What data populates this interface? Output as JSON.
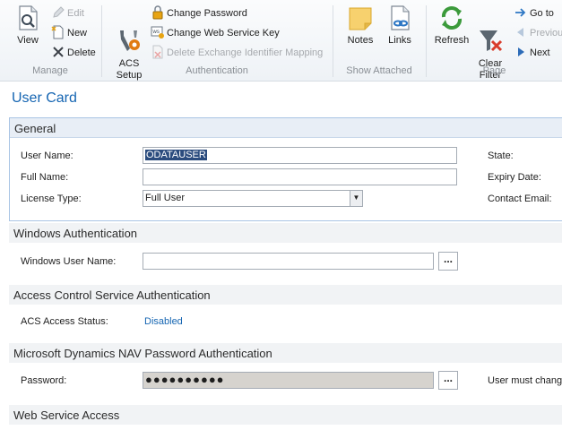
{
  "ribbon": {
    "manage": {
      "label": "Manage",
      "view": "View",
      "edit": "Edit",
      "new": "New",
      "delete": "Delete"
    },
    "authentication": {
      "label": "Authentication",
      "acs_setup": "ACS\nSetup",
      "change_password": "Change Password",
      "change_ws_key": "Change Web Service Key",
      "delete_exchange": "Delete Exchange Identifier Mapping"
    },
    "show_attached": {
      "label": "Show Attached",
      "notes": "Notes",
      "links": "Links"
    },
    "page": {
      "label": "Page",
      "refresh": "Refresh",
      "clear_filter": "Clear\nFilter",
      "go_to": "Go to",
      "previous": "Previou",
      "next": "Next"
    }
  },
  "title": "User Card",
  "general": {
    "header": "General",
    "user_name_label": "User Name:",
    "user_name_value": "ODATAUSER",
    "full_name_label": "Full Name:",
    "full_name_value": "",
    "license_type_label": "License Type:",
    "license_type_value": "Full User",
    "state_label": "State:",
    "expiry_label": "Expiry Date:",
    "contact_email_label": "Contact Email:"
  },
  "windows_auth": {
    "header": "Windows Authentication",
    "windows_user_label": "Windows User Name:",
    "windows_user_value": "",
    "lookup": "..."
  },
  "acs_auth": {
    "header": "Access Control Service Authentication",
    "status_label": "ACS Access Status:",
    "status_value": "Disabled"
  },
  "nav_password_auth": {
    "header": "Microsoft Dynamics NAV Password Authentication",
    "password_label": "Password:",
    "password_value": "●●●●●●●●●●",
    "assist": "...",
    "must_change_label": "User must change"
  },
  "web_service": {
    "header": "Web Service Access"
  },
  "colors": {
    "accent": "#1565b2",
    "selection": "#2b4c7e",
    "section_bg": "#f1f3f5",
    "focused_border": "#a9c4e4"
  }
}
